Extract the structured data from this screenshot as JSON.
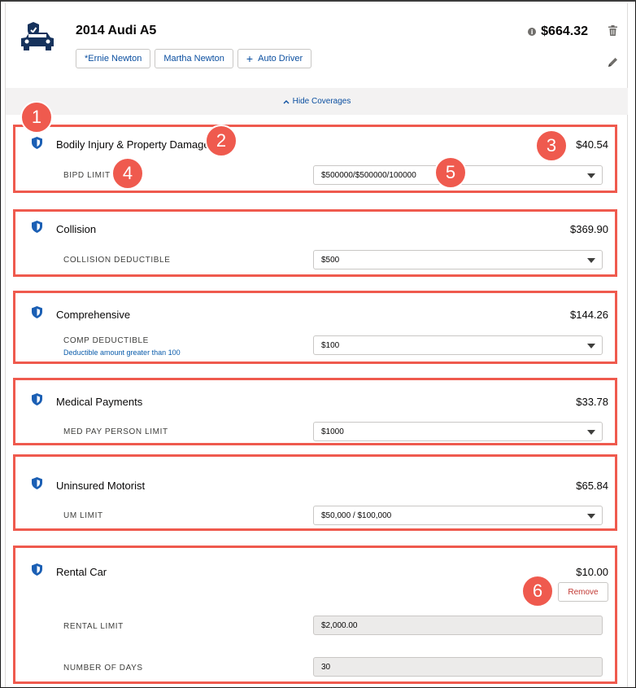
{
  "vehicle": {
    "title": "2014 Audi A5",
    "premium": "$664.32",
    "info_glyph": "i",
    "drivers": [
      "*Ernie Newton",
      "Martha Newton"
    ],
    "add_driver_label": "Auto Driver",
    "icon": "car-shield-icon"
  },
  "hide_coverages_label": "Hide Coverages",
  "coverages": [
    {
      "name": "Bodily Injury & Property Damage",
      "price": "$40.54",
      "field_label": "BIPD LIMIT",
      "value": "$500000/$500000/100000"
    },
    {
      "name": "Collision",
      "price": "$369.90",
      "field_label": "COLLISION DEDUCTIBLE",
      "value": "$500"
    },
    {
      "name": "Comprehensive",
      "price": "$144.26",
      "field_label": "COMP DEDUCTIBLE",
      "help": "Deductible amount greater than 100",
      "value": "$100"
    },
    {
      "name": "Medical Payments",
      "price": "$33.78",
      "field_label": "MED PAY PERSON LIMIT",
      "value": "$1000"
    },
    {
      "name": "Uninsured Motorist",
      "price": "$65.84",
      "field_label": "UM LIMIT",
      "value": "$50,000 / $100,000"
    },
    {
      "name": "Rental Car",
      "price": "$10.00",
      "remove_label": "Remove",
      "fields": [
        {
          "label": "RENTAL LIMIT",
          "value": "$2,000.00"
        },
        {
          "label": "NUMBER OF DAYS",
          "value": "30"
        }
      ]
    }
  ],
  "callouts": [
    "1",
    "2",
    "3",
    "4",
    "5",
    "6"
  ],
  "colors": {
    "callout": "#ef5a4e",
    "link_blue": "#0b4fa0",
    "shield_blue": "#1b5fb4",
    "remove_red": "#c23934"
  }
}
